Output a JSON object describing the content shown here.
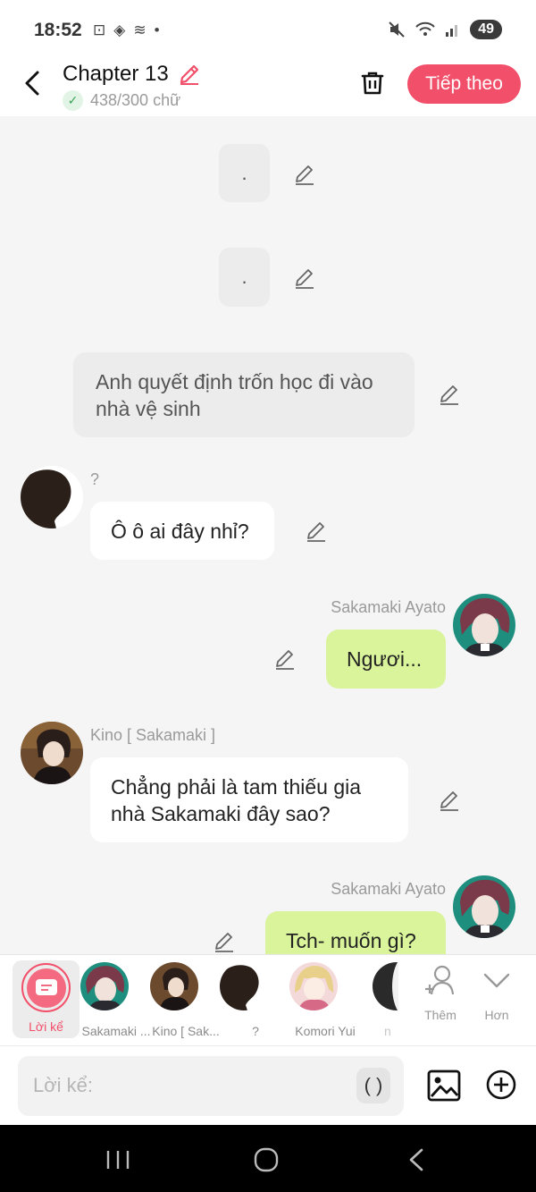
{
  "status_bar": {
    "time": "18:52",
    "battery": "49",
    "left_icons": [
      "screenshot-icon",
      "location-icon",
      "signal-lines-icon",
      "dot-icon"
    ],
    "right_icons": [
      "mute-icon",
      "wifi-icon",
      "cell-signal-icon"
    ]
  },
  "header": {
    "title": "Chapter 13",
    "word_count": "438/300 chữ",
    "next_label": "Tiếp theo",
    "accent_color": "#f24f6a"
  },
  "chat": {
    "messages": [
      {
        "kind": "narration",
        "text": "."
      },
      {
        "kind": "narration",
        "text": "."
      },
      {
        "kind": "narration",
        "text": "Anh quyết định trốn học đi vào nhà vệ sinh"
      },
      {
        "kind": "left",
        "speaker": "?",
        "text": "Ô ô ai đây nhỉ?"
      },
      {
        "kind": "right",
        "speaker": "Sakamaki Ayato",
        "text": "Ngươi..."
      },
      {
        "kind": "left",
        "speaker": "Kino [ Sakamaki ]",
        "text": "Chẳng phải là tam thiếu gia nhà Sakamaki đây sao?"
      },
      {
        "kind": "right",
        "speaker": "Sakamaki Ayato",
        "text": "Tch- muốn gì?"
      }
    ]
  },
  "character_bar": {
    "narrator_label": "Lời kể",
    "characters": [
      {
        "label": "Sakamaki ..."
      },
      {
        "label": "Kino [ Sak..."
      },
      {
        "label": "?"
      },
      {
        "label": "Komori Yui"
      },
      {
        "label": "n"
      }
    ],
    "more_label": "Thêm",
    "collapse_label": "Hơn"
  },
  "input_bar": {
    "placeholder": "Lời kể:",
    "paren_label": "( )"
  }
}
